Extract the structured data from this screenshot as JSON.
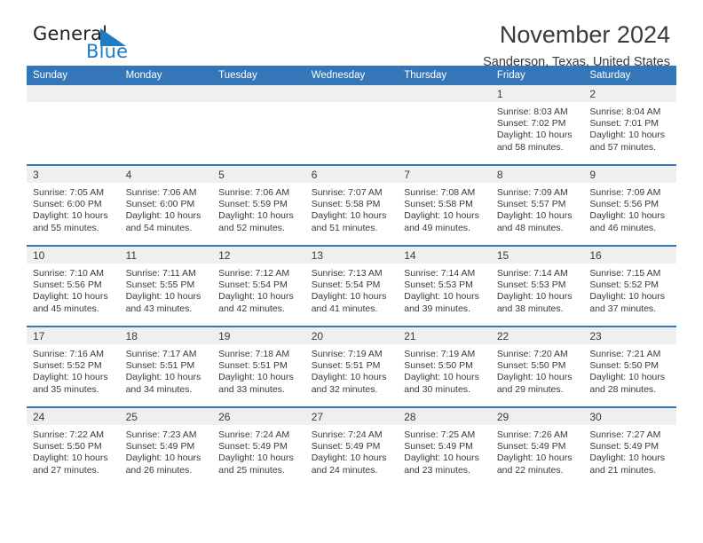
{
  "brand": {
    "name_part1": "General",
    "name_part2": "Blue",
    "mark_icon": "triangle-logo-icon",
    "accent_color": "#1e7bc4"
  },
  "header": {
    "title": "November 2024",
    "subtitle": "Sanderson, Texas, United States"
  },
  "calendar": {
    "header_bg": "#3576b8",
    "daynum_bg": "#efeff0",
    "weekdays": [
      "Sunday",
      "Monday",
      "Tuesday",
      "Wednesday",
      "Thursday",
      "Friday",
      "Saturday"
    ],
    "weeks": [
      [
        {
          "day": "",
          "sunrise": "",
          "sunset": "",
          "daylight_line1": "",
          "daylight_line2": "",
          "empty": true
        },
        {
          "day": "",
          "sunrise": "",
          "sunset": "",
          "daylight_line1": "",
          "daylight_line2": "",
          "empty": true
        },
        {
          "day": "",
          "sunrise": "",
          "sunset": "",
          "daylight_line1": "",
          "daylight_line2": "",
          "empty": true
        },
        {
          "day": "",
          "sunrise": "",
          "sunset": "",
          "daylight_line1": "",
          "daylight_line2": "",
          "empty": true
        },
        {
          "day": "",
          "sunrise": "",
          "sunset": "",
          "daylight_line1": "",
          "daylight_line2": "",
          "empty": true
        },
        {
          "day": "1",
          "sunrise": "Sunrise: 8:03 AM",
          "sunset": "Sunset: 7:02 PM",
          "daylight_line1": "Daylight: 10 hours",
          "daylight_line2": "and 58 minutes."
        },
        {
          "day": "2",
          "sunrise": "Sunrise: 8:04 AM",
          "sunset": "Sunset: 7:01 PM",
          "daylight_line1": "Daylight: 10 hours",
          "daylight_line2": "and 57 minutes."
        }
      ],
      [
        {
          "day": "3",
          "sunrise": "Sunrise: 7:05 AM",
          "sunset": "Sunset: 6:00 PM",
          "daylight_line1": "Daylight: 10 hours",
          "daylight_line2": "and 55 minutes."
        },
        {
          "day": "4",
          "sunrise": "Sunrise: 7:06 AM",
          "sunset": "Sunset: 6:00 PM",
          "daylight_line1": "Daylight: 10 hours",
          "daylight_line2": "and 54 minutes."
        },
        {
          "day": "5",
          "sunrise": "Sunrise: 7:06 AM",
          "sunset": "Sunset: 5:59 PM",
          "daylight_line1": "Daylight: 10 hours",
          "daylight_line2": "and 52 minutes."
        },
        {
          "day": "6",
          "sunrise": "Sunrise: 7:07 AM",
          "sunset": "Sunset: 5:58 PM",
          "daylight_line1": "Daylight: 10 hours",
          "daylight_line2": "and 51 minutes."
        },
        {
          "day": "7",
          "sunrise": "Sunrise: 7:08 AM",
          "sunset": "Sunset: 5:58 PM",
          "daylight_line1": "Daylight: 10 hours",
          "daylight_line2": "and 49 minutes."
        },
        {
          "day": "8",
          "sunrise": "Sunrise: 7:09 AM",
          "sunset": "Sunset: 5:57 PM",
          "daylight_line1": "Daylight: 10 hours",
          "daylight_line2": "and 48 minutes."
        },
        {
          "day": "9",
          "sunrise": "Sunrise: 7:09 AM",
          "sunset": "Sunset: 5:56 PM",
          "daylight_line1": "Daylight: 10 hours",
          "daylight_line2": "and 46 minutes."
        }
      ],
      [
        {
          "day": "10",
          "sunrise": "Sunrise: 7:10 AM",
          "sunset": "Sunset: 5:56 PM",
          "daylight_line1": "Daylight: 10 hours",
          "daylight_line2": "and 45 minutes."
        },
        {
          "day": "11",
          "sunrise": "Sunrise: 7:11 AM",
          "sunset": "Sunset: 5:55 PM",
          "daylight_line1": "Daylight: 10 hours",
          "daylight_line2": "and 43 minutes."
        },
        {
          "day": "12",
          "sunrise": "Sunrise: 7:12 AM",
          "sunset": "Sunset: 5:54 PM",
          "daylight_line1": "Daylight: 10 hours",
          "daylight_line2": "and 42 minutes."
        },
        {
          "day": "13",
          "sunrise": "Sunrise: 7:13 AM",
          "sunset": "Sunset: 5:54 PM",
          "daylight_line1": "Daylight: 10 hours",
          "daylight_line2": "and 41 minutes."
        },
        {
          "day": "14",
          "sunrise": "Sunrise: 7:14 AM",
          "sunset": "Sunset: 5:53 PM",
          "daylight_line1": "Daylight: 10 hours",
          "daylight_line2": "and 39 minutes."
        },
        {
          "day": "15",
          "sunrise": "Sunrise: 7:14 AM",
          "sunset": "Sunset: 5:53 PM",
          "daylight_line1": "Daylight: 10 hours",
          "daylight_line2": "and 38 minutes."
        },
        {
          "day": "16",
          "sunrise": "Sunrise: 7:15 AM",
          "sunset": "Sunset: 5:52 PM",
          "daylight_line1": "Daylight: 10 hours",
          "daylight_line2": "and 37 minutes."
        }
      ],
      [
        {
          "day": "17",
          "sunrise": "Sunrise: 7:16 AM",
          "sunset": "Sunset: 5:52 PM",
          "daylight_line1": "Daylight: 10 hours",
          "daylight_line2": "and 35 minutes."
        },
        {
          "day": "18",
          "sunrise": "Sunrise: 7:17 AM",
          "sunset": "Sunset: 5:51 PM",
          "daylight_line1": "Daylight: 10 hours",
          "daylight_line2": "and 34 minutes."
        },
        {
          "day": "19",
          "sunrise": "Sunrise: 7:18 AM",
          "sunset": "Sunset: 5:51 PM",
          "daylight_line1": "Daylight: 10 hours",
          "daylight_line2": "and 33 minutes."
        },
        {
          "day": "20",
          "sunrise": "Sunrise: 7:19 AM",
          "sunset": "Sunset: 5:51 PM",
          "daylight_line1": "Daylight: 10 hours",
          "daylight_line2": "and 32 minutes."
        },
        {
          "day": "21",
          "sunrise": "Sunrise: 7:19 AM",
          "sunset": "Sunset: 5:50 PM",
          "daylight_line1": "Daylight: 10 hours",
          "daylight_line2": "and 30 minutes."
        },
        {
          "day": "22",
          "sunrise": "Sunrise: 7:20 AM",
          "sunset": "Sunset: 5:50 PM",
          "daylight_line1": "Daylight: 10 hours",
          "daylight_line2": "and 29 minutes."
        },
        {
          "day": "23",
          "sunrise": "Sunrise: 7:21 AM",
          "sunset": "Sunset: 5:50 PM",
          "daylight_line1": "Daylight: 10 hours",
          "daylight_line2": "and 28 minutes."
        }
      ],
      [
        {
          "day": "24",
          "sunrise": "Sunrise: 7:22 AM",
          "sunset": "Sunset: 5:50 PM",
          "daylight_line1": "Daylight: 10 hours",
          "daylight_line2": "and 27 minutes."
        },
        {
          "day": "25",
          "sunrise": "Sunrise: 7:23 AM",
          "sunset": "Sunset: 5:49 PM",
          "daylight_line1": "Daylight: 10 hours",
          "daylight_line2": "and 26 minutes."
        },
        {
          "day": "26",
          "sunrise": "Sunrise: 7:24 AM",
          "sunset": "Sunset: 5:49 PM",
          "daylight_line1": "Daylight: 10 hours",
          "daylight_line2": "and 25 minutes."
        },
        {
          "day": "27",
          "sunrise": "Sunrise: 7:24 AM",
          "sunset": "Sunset: 5:49 PM",
          "daylight_line1": "Daylight: 10 hours",
          "daylight_line2": "and 24 minutes."
        },
        {
          "day": "28",
          "sunrise": "Sunrise: 7:25 AM",
          "sunset": "Sunset: 5:49 PM",
          "daylight_line1": "Daylight: 10 hours",
          "daylight_line2": "and 23 minutes."
        },
        {
          "day": "29",
          "sunrise": "Sunrise: 7:26 AM",
          "sunset": "Sunset: 5:49 PM",
          "daylight_line1": "Daylight: 10 hours",
          "daylight_line2": "and 22 minutes."
        },
        {
          "day": "30",
          "sunrise": "Sunrise: 7:27 AM",
          "sunset": "Sunset: 5:49 PM",
          "daylight_line1": "Daylight: 10 hours",
          "daylight_line2": "and 21 minutes."
        }
      ]
    ]
  }
}
